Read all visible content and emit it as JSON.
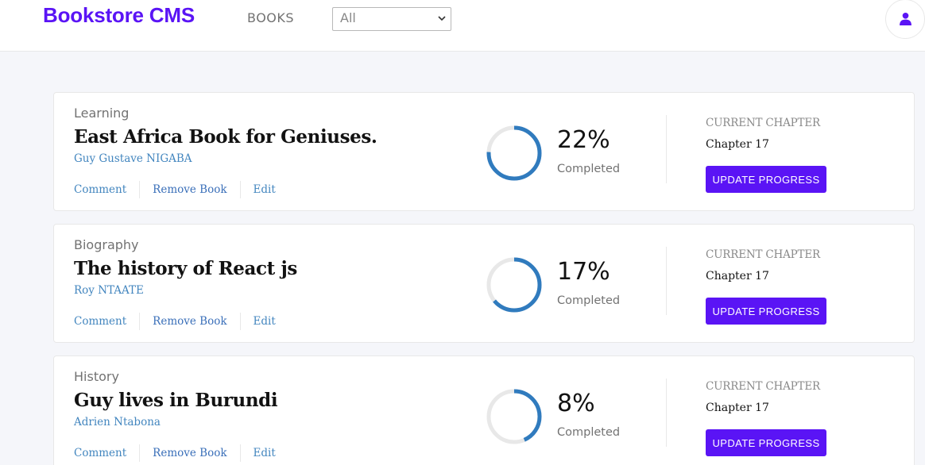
{
  "header": {
    "brand": "Bookstore CMS",
    "nav_books": "BOOKS",
    "category_filter": {
      "selected": "All"
    },
    "user_icon": "user-icon"
  },
  "colors": {
    "brand": "#5a14f5",
    "link": "#4386bf",
    "progress": "#307bbe",
    "track": "#e8e8e8"
  },
  "labels": {
    "completed": "Completed",
    "current_chapter": "CURRENT CHAPTER",
    "update_progress": "UPDATE PROGRESS",
    "comment": "Comment",
    "remove": "Remove Book",
    "edit": "Edit"
  },
  "books": [
    {
      "genre": "Learning",
      "title": "East Africa Book for Geniuses.",
      "author": "Guy Gustave NIGABA",
      "progress_percent": 22,
      "progress_label": "22%",
      "chapter": "Chapter 17"
    },
    {
      "genre": "Biography",
      "title": "The history of React js",
      "author": "Roy NTAATE",
      "progress_percent": 17,
      "progress_label": "17%",
      "chapter": "Chapter 17"
    },
    {
      "genre": "History",
      "title": "Guy lives in Burundi",
      "author": "Adrien Ntabona",
      "progress_percent": 8,
      "progress_label": "8%",
      "chapter": "Chapter 17"
    }
  ]
}
